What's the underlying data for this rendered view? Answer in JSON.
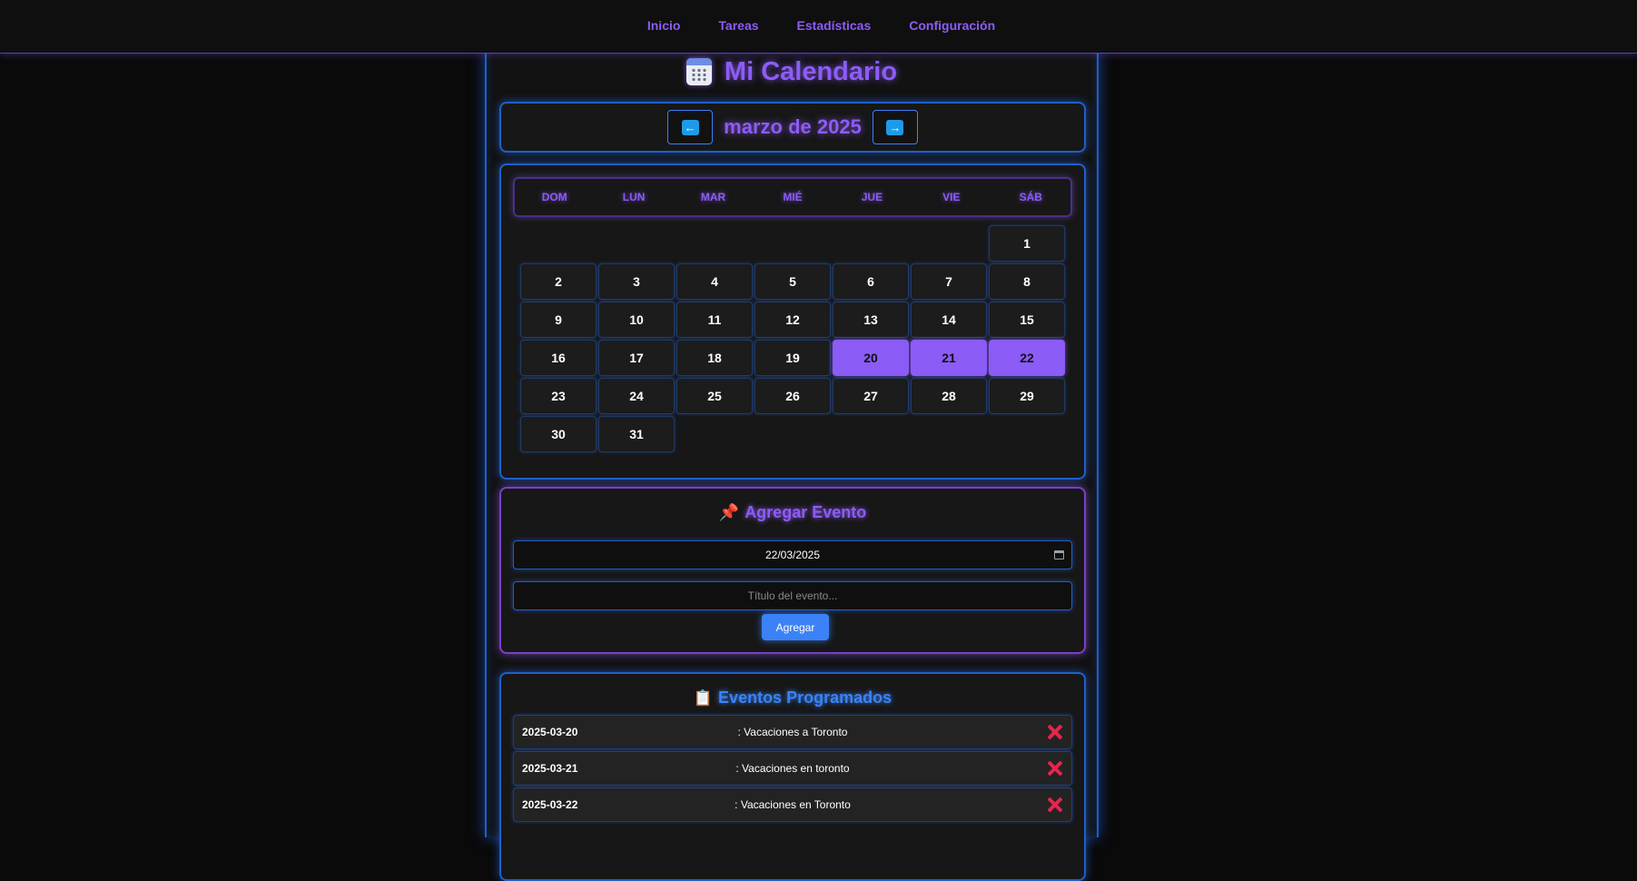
{
  "nav": {
    "links": [
      "Inicio",
      "Tareas",
      "Estadísticas",
      "Configuración"
    ]
  },
  "header": {
    "title": "Mi Calendario",
    "icon": "calendar-icon"
  },
  "month_nav": {
    "label": "marzo de 2025",
    "prev_icon": "arrow-left-icon",
    "next_icon": "arrow-right-icon"
  },
  "calendar": {
    "weekdays": [
      "DOM",
      "LUN",
      "MAR",
      "MIÉ",
      "JUE",
      "VIE",
      "SÁB"
    ],
    "leading_blank_days": 6,
    "days_in_month": 31,
    "highlighted_days": [
      20,
      21,
      22
    ],
    "highlight_color": "#8b5cf6"
  },
  "add_event": {
    "title": "Agregar Evento",
    "icon": "pushpin-icon",
    "date_value": "22/03/2025",
    "title_placeholder": "Título del evento...",
    "button_label": "Agregar"
  },
  "events": {
    "title": "Eventos Programados",
    "icon": "clipboard-icon",
    "items": [
      {
        "date": "2025-03-20",
        "name": ": Vacaciones a Toronto"
      },
      {
        "date": "2025-03-21",
        "name": ": Vacaciones en toronto"
      },
      {
        "date": "2025-03-22",
        "name": ": Vacaciones en Toronto"
      }
    ]
  },
  "colors": {
    "accent_purple": "#8d5cf6",
    "accent_blue": "#3b82f6",
    "delete_red": "#e5254d"
  }
}
